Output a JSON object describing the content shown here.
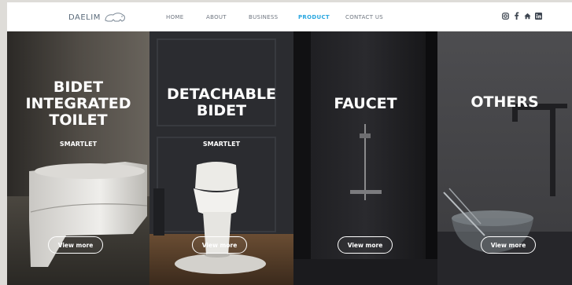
{
  "header": {
    "logo_text": "DAELIM",
    "nav": [
      {
        "label": "HOME"
      },
      {
        "label": "ABOUT"
      },
      {
        "label": "BUSINESS"
      },
      {
        "label": "PRODUCT",
        "active": true
      },
      {
        "label": "CONTACT US"
      }
    ],
    "social_icons": [
      "instagram-icon",
      "facebook-icon",
      "home-icon",
      "linkedin-icon"
    ]
  },
  "panels": [
    {
      "title": "BIDET\nINTEGRATED\nTOILET",
      "subtitle": "SMARTLET",
      "button": "View more"
    },
    {
      "title": "DETACHABLE\nBIDET",
      "subtitle": "SMARTLET",
      "button": "View more"
    },
    {
      "title": "FAUCET",
      "subtitle": "",
      "button": "View more"
    },
    {
      "title": "OTHERS",
      "subtitle": "",
      "button": "View more"
    }
  ],
  "colors": {
    "accent": "#2aa7e0",
    "header_bg": "#ffffff",
    "panel_text": "#ffffff"
  }
}
